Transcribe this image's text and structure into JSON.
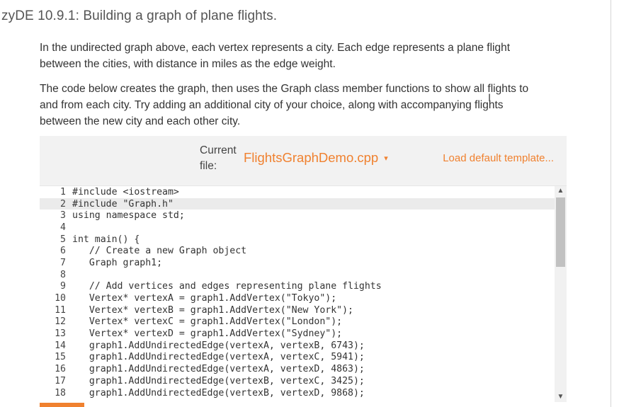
{
  "title": "zyDE 10.9.1: Building a graph of plane flights.",
  "paragraphs": {
    "p1": [
      "In the undirected graph above, each vertex represents a city. Each edge represents a plane flight",
      "between the cities, with distance in miles as the edge weight."
    ],
    "p2": [
      "The code below creates the graph, then uses the Graph class member functions to show all flights to",
      "and from each city. Try adding an additional city of your choice, along with accompanying flights",
      "between the new city and each other city."
    ]
  },
  "toolbar": {
    "current_label_line1": "Current",
    "current_label_line2": "file:",
    "file_name": "FlightsGraphDemo.cpp",
    "file_caret": "▾",
    "load_link": "Load default template..."
  },
  "code_lines": [
    {
      "n": "1",
      "text": "#include <iostream>"
    },
    {
      "n": "2",
      "text": "#include \"Graph.h\""
    },
    {
      "n": "3",
      "text": "using namespace std;"
    },
    {
      "n": "4",
      "text": ""
    },
    {
      "n": "5",
      "text": "int main() {"
    },
    {
      "n": "6",
      "text": "   // Create a new Graph object"
    },
    {
      "n": "7",
      "text": "   Graph graph1;"
    },
    {
      "n": "8",
      "text": ""
    },
    {
      "n": "9",
      "text": "   // Add vertices and edges representing plane flights"
    },
    {
      "n": "10",
      "text": "   Vertex* vertexA = graph1.AddVertex(\"Tokyo\");"
    },
    {
      "n": "11",
      "text": "   Vertex* vertexB = graph1.AddVertex(\"New York\");"
    },
    {
      "n": "12",
      "text": "   Vertex* vertexC = graph1.AddVertex(\"London\");"
    },
    {
      "n": "13",
      "text": "   Vertex* vertexD = graph1.AddVertex(\"Sydney\");"
    },
    {
      "n": "14",
      "text": "   graph1.AddUndirectedEdge(vertexA, vertexB, 6743);"
    },
    {
      "n": "15",
      "text": "   graph1.AddUndirectedEdge(vertexA, vertexC, 5941);"
    },
    {
      "n": "16",
      "text": "   graph1.AddUndirectedEdge(vertexA, vertexD, 4863);"
    },
    {
      "n": "17",
      "text": "   graph1.AddUndirectedEdge(vertexB, vertexC, 3425);"
    },
    {
      "n": "18",
      "text": "   graph1.AddUndirectedEdge(vertexB, vertexD, 9868);"
    }
  ],
  "active_line": 2,
  "icons": {
    "scroll_up": "scroll-up-arrow-icon",
    "scroll_down": "scroll-down-arrow-icon",
    "dropdown": "chevron-down-icon"
  },
  "colors": {
    "accent": "#f0812f",
    "editor_active_line": "#ebebeb",
    "toolbar_background": "#f2f2f2"
  }
}
